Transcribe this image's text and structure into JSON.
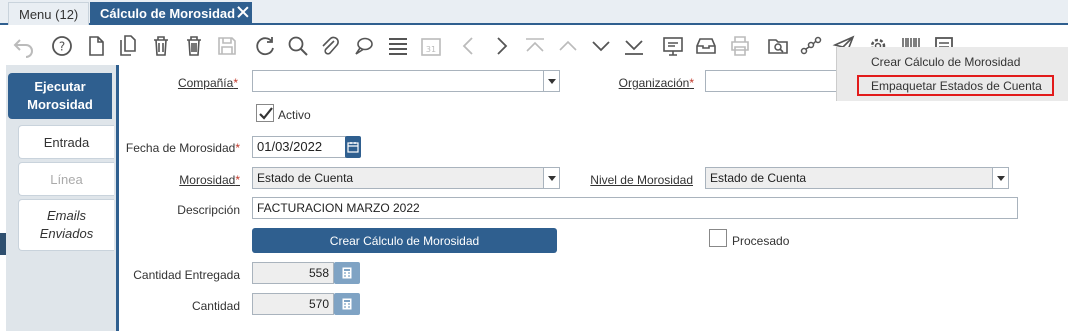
{
  "tabs": {
    "menu": "Menu (12)",
    "active": "Cálculo de Morosidad"
  },
  "toolbar": {
    "icons": [
      "undo-icon",
      "help-icon",
      "new-icon",
      "copy-icon",
      "delete-icon",
      "delete-selection-icon",
      "save-icon",
      "refresh-icon",
      "find-icon",
      "attachment-icon",
      "chat-icon",
      "grid-toggle-icon",
      "calendar-icon",
      "previous-icon",
      "next-icon",
      "first-icon",
      "parent-icon",
      "detail-icon",
      "last-icon",
      "report-icon",
      "archive-icon",
      "print-icon",
      "zoom-across-icon",
      "workflow-icon",
      "send-icon",
      "settings-icon",
      "barcode-icon",
      "process-icon"
    ]
  },
  "side": {
    "execute": "Ejecutar Morosidad",
    "entrada": "Entrada",
    "linea": "Línea",
    "emails": "Emails Enviados"
  },
  "form": {
    "compania_label": "Compañía",
    "compania_value": "",
    "organizacion_label": "Organización",
    "organizacion_value": "",
    "activo_label": "Activo",
    "activo_checked": true,
    "fecha_label": "Fecha de Morosidad",
    "fecha_value": "01/03/2022",
    "morosidad_label": "Morosidad",
    "morosidad_value": "Estado de Cuenta",
    "nivel_label": "Nivel de Morosidad",
    "nivel_value": "Estado de Cuenta",
    "descripcion_label": "Descripción",
    "descripcion_value": "FACTURACION MARZO 2022",
    "crear_button": "Crear Cálculo de Morosidad",
    "procesado_label": "Procesado",
    "procesado_checked": false,
    "cant_entregada_label": "Cantidad Entregada",
    "cant_entregada_value": "558",
    "cantidad_label": "Cantidad",
    "cantidad_value": "570",
    "required_mark": "*"
  },
  "popup": {
    "item1": "Crear Cálculo de Morosidad",
    "item2": "Empaquetar Estados de Cuenta"
  },
  "colors": {
    "primary": "#2f5f8f",
    "highlight": "#e21b1b"
  }
}
